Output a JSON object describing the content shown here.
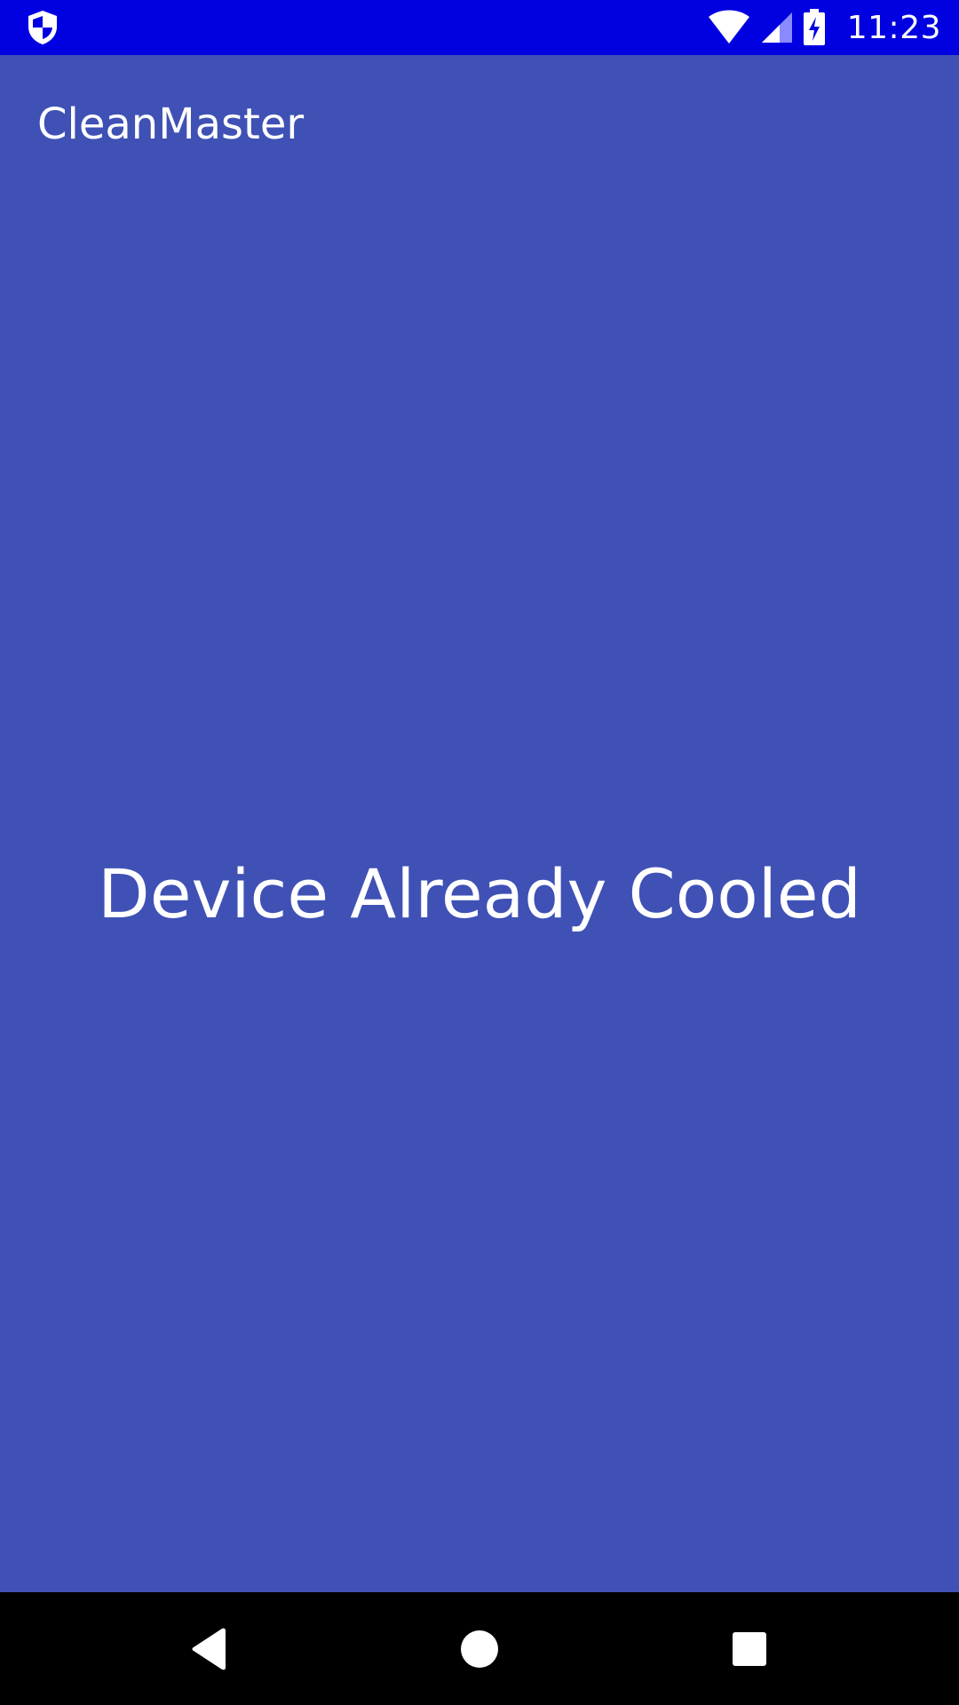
{
  "colors": {
    "status_bar": "#0000e0",
    "app_background": "#3f51b5",
    "nav_bar": "#000000",
    "text": "#ffffff"
  },
  "status_bar": {
    "left_icon": "shield-icon",
    "icons": [
      "wifi-icon",
      "cell-signal-icon",
      "battery-charging-icon"
    ],
    "time": "11:23"
  },
  "app": {
    "title": "CleanMaster",
    "message": "Device Already Cooled"
  },
  "nav_bar": {
    "buttons": [
      "back-icon",
      "home-icon",
      "recents-icon"
    ]
  }
}
